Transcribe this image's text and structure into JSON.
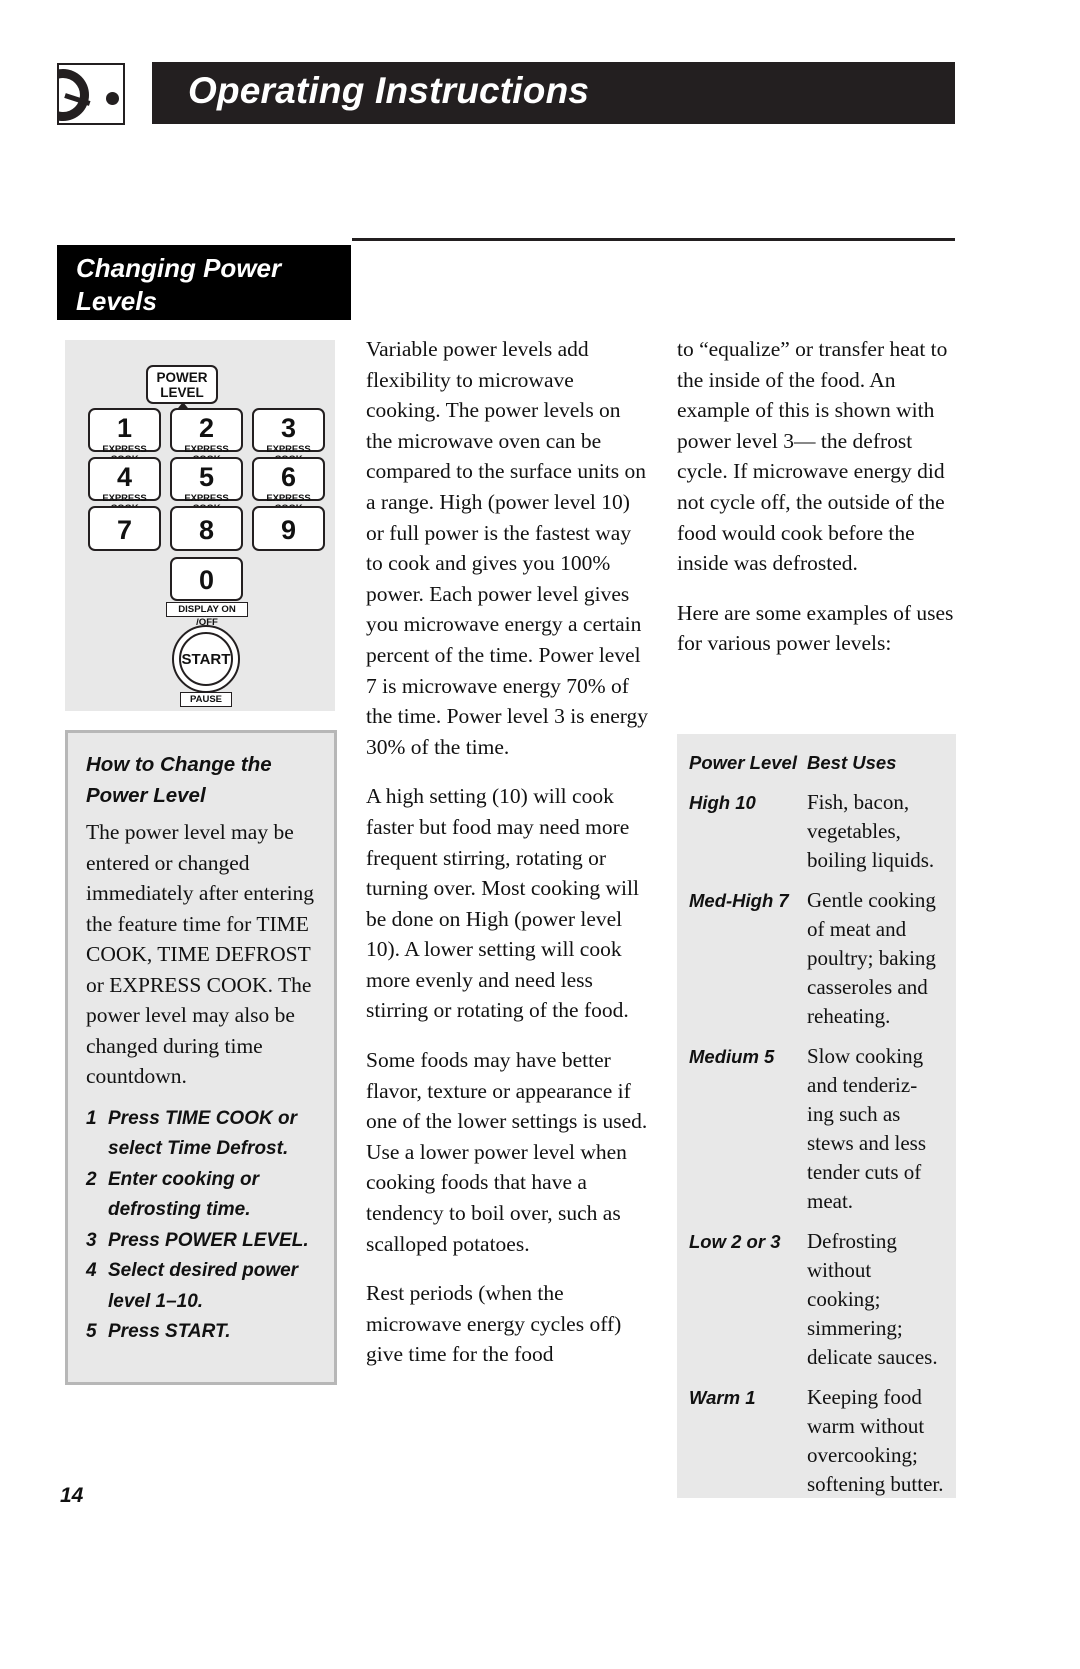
{
  "header": {
    "title": "Operating Instructions",
    "icon": "microwave-dial-icon"
  },
  "section": {
    "title_line1": "Changing Power",
    "title_line2": "Levels"
  },
  "keypad": {
    "power_level_line1": "POWER",
    "power_level_line2": "LEVEL",
    "keys": [
      {
        "num": "1",
        "sub": "EXPRESS COOK"
      },
      {
        "num": "2",
        "sub": "EXPRESS COOK"
      },
      {
        "num": "3",
        "sub": "EXPRESS COOK"
      },
      {
        "num": "4",
        "sub": "EXPRESS COOK"
      },
      {
        "num": "5",
        "sub": "EXPRESS COOK"
      },
      {
        "num": "6",
        "sub": "EXPRESS COOK"
      },
      {
        "num": "7",
        "sub": ""
      },
      {
        "num": "8",
        "sub": ""
      },
      {
        "num": "9",
        "sub": ""
      },
      {
        "num": "0",
        "sub": ""
      }
    ],
    "display_label": "DISPLAY ON /OFF",
    "start_label": "START",
    "pause_label": "PAUSE"
  },
  "howto": {
    "title_line1": "How to Change the",
    "title_line2": "Power Level",
    "body": "The power level may be entered or changed immediately after entering the feature time for TIME COOK, TIME DEFROST or EXPRESS COOK. The power level may also be changed during time countdown.",
    "steps": [
      {
        "n": "1",
        "text": "Press TIME COOK or select Time Defrost."
      },
      {
        "n": "2",
        "text": "Enter cooking or defrosting time."
      },
      {
        "n": "3",
        "text": "Press POWER LEVEL."
      },
      {
        "n": "4",
        "text": "Select desired power level 1–10."
      },
      {
        "n": "5",
        "text": "Press START."
      }
    ]
  },
  "middle_column": {
    "p1": "Variable power levels add flexibility to microwave cooking. The power levels on the microwave oven can be compared to the surface units on a range. High (power level 10) or full power is the fastest way to cook and gives you 100% power. Each power level gives you microwave energy a certain percent of the time. Power level 7 is microwave energy 70% of the time. Power level 3 is energy 30% of the time.",
    "p2": "A high setting (10) will cook faster but food may need more frequent stirring, rotating or turning over. Most cooking will be done on High (power level 10). A lower setting will cook more evenly and need less stirring or rotating of the food.",
    "p3": "Some foods may have better flavor, texture or appearance if one of the lower settings is used. Use a lower power level when cooking foods that have a tendency to boil over, such as scalloped potatoes.",
    "p4": "Rest periods (when the microwave energy cycles off) give time for the food"
  },
  "right_column": {
    "p1": "to “equalize” or transfer heat to the inside of the food. An example of this is shown with power level 3— the defrost cycle. If microwave energy did not cycle off, the outside of the food would cook before the inside was defrosted.",
    "p2": "Here are some examples of uses for various power levels:"
  },
  "uses_table": {
    "header": {
      "col1": "Power Level",
      "col2": "Best Uses"
    },
    "rows": [
      {
        "level": "High 10",
        "uses": "Fish, bacon, vegetables, boiling liquids."
      },
      {
        "level": "Med-High 7",
        "uses": "Gentle cooking of meat and poultry; baking casseroles and reheating."
      },
      {
        "level": "Medium 5",
        "uses": "Slow cooking and tenderiz- ing such as stews and less tender cuts of meat."
      },
      {
        "level": "Low 2 or 3",
        "uses": "Defrosting without cooking; simmering; delicate sauces."
      },
      {
        "level": "Warm 1",
        "uses": "Keeping food warm without overcooking; softening butter."
      }
    ]
  },
  "page_number": "14",
  "colors": {
    "ink": "#231f20",
    "panel_gray": "#e8e8e8",
    "box_border_gray": "#b7b7b7"
  }
}
